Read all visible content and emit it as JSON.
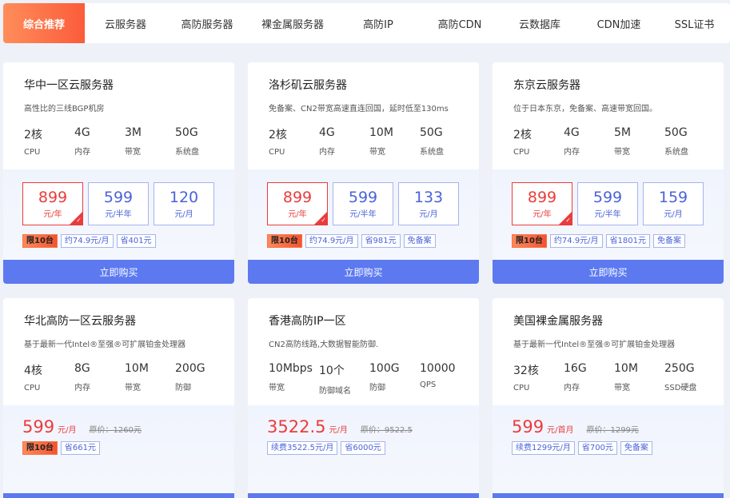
{
  "tabs": [
    "综合推荐",
    "云服务器",
    "高防服务器",
    "裸金属服务器",
    "高防IP",
    "高防CDN",
    "云数据库",
    "CDN加速",
    "SSL证书"
  ],
  "buy_label": "立即购买",
  "cards_row1": [
    {
      "title": "华中一区云服务器",
      "desc": "高性比的三线BGP机房",
      "specs": [
        {
          "v": "2核",
          "l": "CPU"
        },
        {
          "v": "4G",
          "l": "内存"
        },
        {
          "v": "3M",
          "l": "带宽"
        },
        {
          "v": "50G",
          "l": "系统盘"
        }
      ],
      "prices": [
        {
          "amt": "899",
          "unit": "元/年"
        },
        {
          "amt": "599",
          "unit": "元/半年"
        },
        {
          "amt": "120",
          "unit": "元/月"
        }
      ],
      "tags": [
        "限10台",
        "约74.9元/月",
        "省401元"
      ]
    },
    {
      "title": "洛杉矶云服务器",
      "desc": "免备案、CN2带宽高速直连回国，延时低至130ms",
      "specs": [
        {
          "v": "2核",
          "l": "CPU"
        },
        {
          "v": "4G",
          "l": "内存"
        },
        {
          "v": "10M",
          "l": "带宽"
        },
        {
          "v": "50G",
          "l": "系统盘"
        }
      ],
      "prices": [
        {
          "amt": "899",
          "unit": "元/年"
        },
        {
          "amt": "599",
          "unit": "元/半年"
        },
        {
          "amt": "133",
          "unit": "元/月"
        }
      ],
      "tags": [
        "限10台",
        "约74.9元/月",
        "省981元",
        "免备案"
      ]
    },
    {
      "title": "东京云服务器",
      "desc": "位于日本东京，免备案、高速带宽回国。",
      "specs": [
        {
          "v": "2核",
          "l": "CPU"
        },
        {
          "v": "4G",
          "l": "内存"
        },
        {
          "v": "5M",
          "l": "带宽"
        },
        {
          "v": "50G",
          "l": "系统盘"
        }
      ],
      "prices": [
        {
          "amt": "899",
          "unit": "元/年"
        },
        {
          "amt": "599",
          "unit": "元/半年"
        },
        {
          "amt": "159",
          "unit": "元/月"
        }
      ],
      "tags": [
        "限10台",
        "约74.9元/月",
        "省1801元",
        "免备案"
      ]
    }
  ],
  "cards_row2": [
    {
      "title": "华北高防一区云服务器",
      "desc": "基于最新一代Intel®至强®可扩展铂金处理器",
      "specs": [
        {
          "v": "4核",
          "l": "CPU"
        },
        {
          "v": "8G",
          "l": "内存"
        },
        {
          "v": "10M",
          "l": "带宽"
        },
        {
          "v": "200G",
          "l": "防御"
        }
      ],
      "price": "599",
      "price_unit": "元/月",
      "orig": "原价：1260元",
      "tags": [
        "限10台",
        "省661元"
      ]
    },
    {
      "title": "香港高防IP一区",
      "desc": "CN2高防线路,大数据智能防御.",
      "specs": [
        {
          "v": "10Mbps",
          "l": "带宽"
        },
        {
          "v": "10个",
          "l": "防御域名"
        },
        {
          "v": "100G",
          "l": "防御"
        },
        {
          "v": "10000",
          "l": "QPS"
        }
      ],
      "price": "3522.5",
      "price_unit": "元/月",
      "orig": "原价：9522.5",
      "tags": [
        "续费3522.5元/月",
        "省6000元"
      ]
    },
    {
      "title": "美国裸金属服务器",
      "desc": "基于最新一代Intel®至强®可扩展铂金处理器",
      "specs": [
        {
          "v": "32核",
          "l": "CPU"
        },
        {
          "v": "16G",
          "l": "内存"
        },
        {
          "v": "10M",
          "l": "带宽"
        },
        {
          "v": "250G",
          "l": "SSD硬盘"
        }
      ],
      "price": "599",
      "price_unit": "元/首月",
      "orig": "原价：1299元",
      "tags": [
        "续费1299元/月",
        "省700元",
        "免备案"
      ]
    }
  ]
}
